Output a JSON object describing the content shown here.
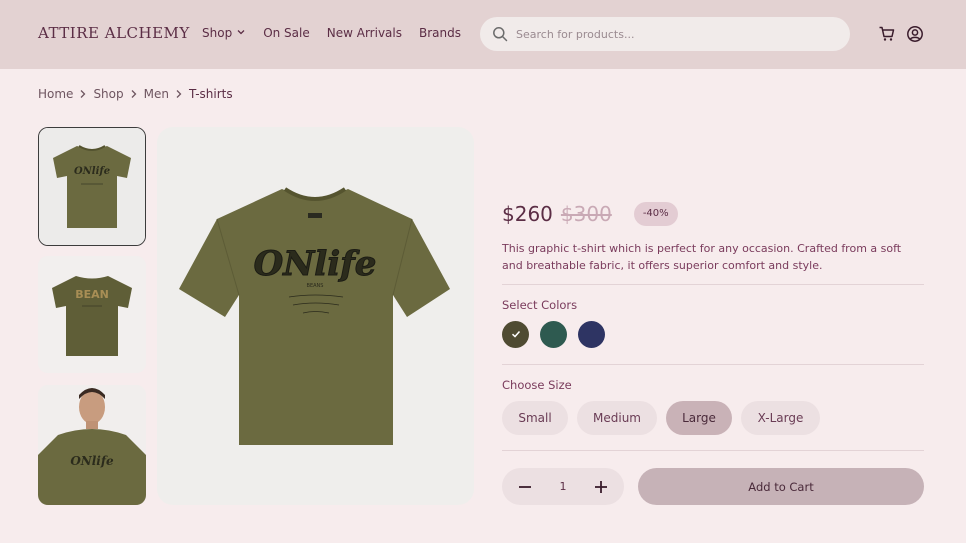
{
  "header": {
    "brand": "ATTIRE ALCHEMY",
    "nav": [
      {
        "label": "Shop",
        "has_dropdown": true
      },
      {
        "label": "On Sale"
      },
      {
        "label": "New Arrivals"
      },
      {
        "label": "Brands"
      }
    ],
    "search_placeholder": "Search for products...",
    "icons": [
      "cart-icon",
      "user-account-icon"
    ]
  },
  "breadcrumb": [
    "Home",
    "Shop",
    "Men",
    "T-shirts"
  ],
  "product": {
    "gallery": {
      "thumbnails": [
        "front-view",
        "back-view",
        "model-view"
      ],
      "active_thumbnail": 0
    },
    "price": "$260",
    "old_price": "$300",
    "discount": "-40%",
    "description": "This graphic t-shirt which is perfect for any occasion. Crafted from a soft and breathable fabric, it offers superior comfort and style.",
    "colors_label": "Select Colors",
    "colors": [
      {
        "hex": "#4f4b32",
        "selected": true
      },
      {
        "hex": "#2e5a50",
        "selected": false
      },
      {
        "hex": "#2e3463",
        "selected": false
      }
    ],
    "size_label": "Choose Size",
    "sizes": [
      "Small",
      "Medium",
      "Large",
      "X-Large"
    ],
    "selected_size": "Large",
    "quantity": "1",
    "add_to_cart": "Add to Cart"
  },
  "colors": {
    "header_bg": "#e3d2d2",
    "page_bg": "#f7eced",
    "text_primary": "#5b2d45",
    "shirt_olive": "#6b6a40"
  }
}
